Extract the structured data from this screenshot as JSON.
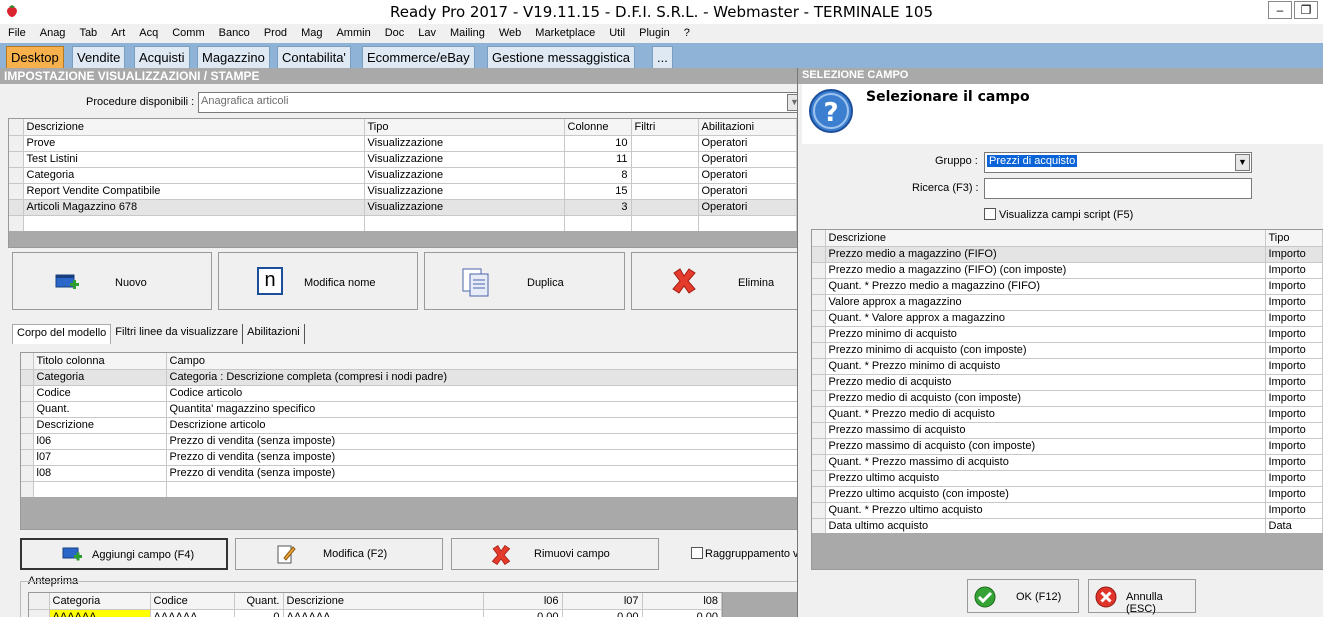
{
  "window": {
    "title": "Ready Pro 2017 - V19.11.15 - D.F.I. S.R.L. - Webmaster - TERMINALE 105",
    "minimize": "–",
    "restore": "❐"
  },
  "menu": [
    "File",
    "Anag",
    "Tab",
    "Art",
    "Acq",
    "Comm",
    "Banco",
    "Prod",
    "Mag",
    "Ammin",
    "Doc",
    "Lav",
    "Mailing",
    "Web",
    "Marketplace",
    "Util",
    "Plugin",
    "?"
  ],
  "main_tabs": [
    "Desktop",
    "Vendite",
    "Acquisti",
    "Magazzino",
    "Contabilita'",
    "Ecommerce/eBay",
    "Gestione messaggistica",
    "..."
  ],
  "left": {
    "header": "IMPOSTAZIONE VISUALIZZAZIONI / STAMPE",
    "procedure_label": "Procedure disponibili :",
    "procedure_value": "Anagrafica articoli",
    "views_columns": [
      "Descrizione",
      "Tipo",
      "Colonne",
      "Filtri",
      "Abilitazioni"
    ],
    "views_rows": [
      [
        "Prove",
        "Visualizzazione",
        "10",
        "",
        "Operatori"
      ],
      [
        "Test Listini",
        "Visualizzazione",
        "11",
        "",
        "Operatori"
      ],
      [
        "Categoria",
        "Visualizzazione",
        "8",
        "",
        "Operatori"
      ],
      [
        "Report Vendite Compatibile",
        "Visualizzazione",
        "15",
        "",
        "Operatori"
      ],
      [
        "Articoli Magazzino 678",
        "Visualizzazione",
        "3",
        "",
        "Operatori"
      ]
    ],
    "buttons": {
      "nuovo": "Nuovo",
      "modifica_nome": "Modifica nome",
      "duplica": "Duplica",
      "elimina": "Elimina",
      "n_glyph": "n"
    },
    "subtabs": [
      "Corpo del modello",
      "Filtri linee da visualizzare",
      "Abilitazioni"
    ],
    "fields_columns": [
      "Titolo colonna",
      "Campo"
    ],
    "fields_rows": [
      [
        "Categoria",
        "Categoria : Descrizione completa (compresi i nodi padre)"
      ],
      [
        "Codice",
        "Codice articolo"
      ],
      [
        "Quant.",
        "Quantita' magazzino specifico"
      ],
      [
        "Descrizione",
        "Descrizione articolo"
      ],
      [
        "l06",
        "Prezzo di vendita (senza imposte)"
      ],
      [
        "l07",
        "Prezzo di vendita (senza imposte)"
      ],
      [
        "l08",
        "Prezzo di vendita (senza imposte)"
      ]
    ],
    "field_buttons": {
      "aggiungi": "Aggiungi campo (F4)",
      "modifica": "Modifica (F2)",
      "rimuovi": "Rimuovi campo"
    },
    "raggruppamento": "Raggruppamento v",
    "anteprima_label": "Anteprima",
    "preview_columns": [
      "Categoria",
      "Codice",
      "Quant.",
      "Descrizione",
      "l06",
      "l07",
      "l08"
    ],
    "preview_row": [
      "AAAAAA",
      "AAAAAA",
      "0",
      "AAAAAA",
      "0,00",
      "0,00",
      "0,00"
    ]
  },
  "dialog": {
    "header": "SELEZIONE CAMPO",
    "title": "Selezionare il campo",
    "question_glyph": "?",
    "gruppo_label": "Gruppo :",
    "gruppo_value": "Prezzi di acquisto",
    "ricerca_label": "Ricerca (F3) :",
    "ricerca_value": "",
    "script_label": "Visualizza campi script (F5)",
    "columns": [
      "Descrizione",
      "Tipo"
    ],
    "rows": [
      [
        "Prezzo medio a magazzino (FIFO)",
        "Importo"
      ],
      [
        "Prezzo medio a magazzino (FIFO) (con imposte)",
        "Importo"
      ],
      [
        "Quant. * Prezzo medio a magazzino (FIFO)",
        "Importo"
      ],
      [
        "Valore approx a magazzino",
        "Importo"
      ],
      [
        "Quant. * Valore approx a magazzino",
        "Importo"
      ],
      [
        "Prezzo minimo di acquisto",
        "Importo"
      ],
      [
        "Prezzo minimo di acquisto (con imposte)",
        "Importo"
      ],
      [
        "Quant. * Prezzo minimo di acquisto",
        "Importo"
      ],
      [
        "Prezzo medio di acquisto",
        "Importo"
      ],
      [
        "Prezzo medio di acquisto (con imposte)",
        "Importo"
      ],
      [
        "Quant. * Prezzo medio di acquisto",
        "Importo"
      ],
      [
        "Prezzo massimo di acquisto",
        "Importo"
      ],
      [
        "Prezzo massimo di acquisto (con imposte)",
        "Importo"
      ],
      [
        "Quant. * Prezzo massimo di acquisto",
        "Importo"
      ],
      [
        "Prezzo ultimo acquisto",
        "Importo"
      ],
      [
        "Prezzo ultimo acquisto (con imposte)",
        "Importo"
      ],
      [
        "Quant. * Prezzo ultimo acquisto",
        "Importo"
      ],
      [
        "Data ultimo acquisto",
        "Data"
      ]
    ],
    "ok": "OK (F12)",
    "annulla": "Annulla (ESC)"
  },
  "colors": {
    "tab_bar": "#8fb3d6",
    "active_tab": "#f6b04c",
    "section_header": "#a9a9a9",
    "selection": "#0a64d8",
    "preview_highlight": "#ffff00"
  }
}
